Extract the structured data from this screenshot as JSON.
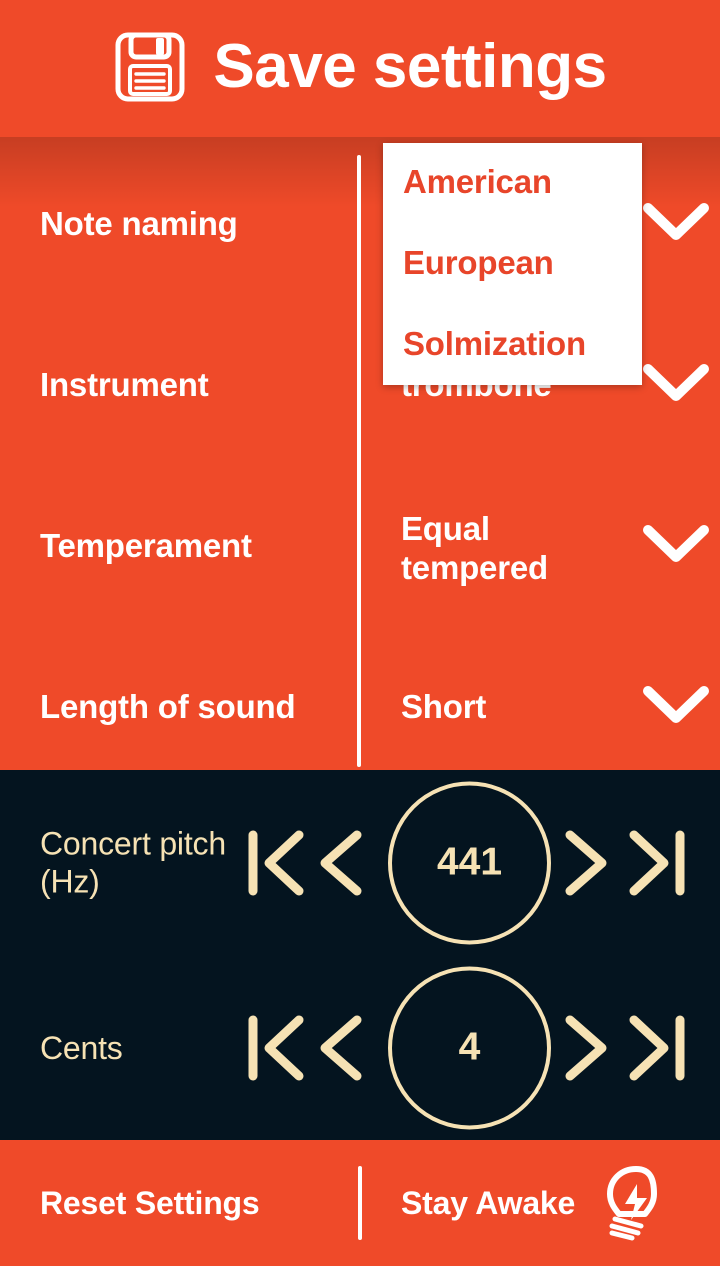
{
  "header": {
    "title": "Save settings",
    "icon": "floppy-disk-save-icon"
  },
  "settings": {
    "rows": [
      {
        "label": "Note naming",
        "value": "",
        "chevron": "chevron-down-icon"
      },
      {
        "label": "Instrument",
        "value": "trombone",
        "chevron": "chevron-down-icon"
      },
      {
        "label": "Temperament",
        "value": "Equal tempered",
        "chevron": "chevron-down-icon"
      },
      {
        "label": "Length of sound",
        "value": "Short",
        "chevron": "chevron-down-icon"
      }
    ]
  },
  "dropdown": {
    "open_for": "Note naming",
    "options": [
      "American",
      "European",
      "Solmization"
    ]
  },
  "steppers": [
    {
      "label": "Concert pitch (Hz)",
      "value": "441",
      "controls": {
        "first": "skip-to-start-icon",
        "prev": "previous-icon",
        "next": "next-icon",
        "last": "skip-to-end-icon"
      }
    },
    {
      "label": "Cents",
      "value": "4",
      "controls": {
        "first": "skip-to-start-icon",
        "prev": "previous-icon",
        "next": "next-icon",
        "last": "skip-to-end-icon"
      }
    }
  ],
  "bottom_bar": {
    "reset_label": "Reset Settings",
    "stay_awake_label": "Stay Awake",
    "stay_awake_icon": "lightbulb-bolt-icon"
  },
  "colors": {
    "accent_orange": "#ef4a29",
    "dark_navy": "#04141f",
    "cream": "#f6e2b4",
    "white": "#ffffff"
  }
}
